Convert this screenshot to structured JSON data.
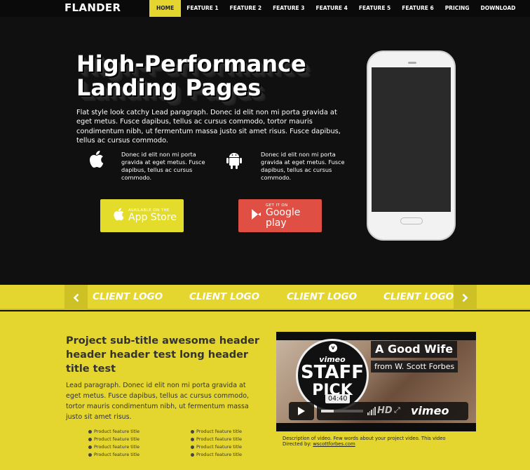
{
  "nav": {
    "brand": "FLANDER",
    "items": [
      {
        "label": "HOME",
        "active": true
      },
      {
        "label": "FEATURE 1"
      },
      {
        "label": "FEATURE 2"
      },
      {
        "label": "FEATURE 3"
      },
      {
        "label": "FEATURE 4"
      },
      {
        "label": "FEATURE 5"
      },
      {
        "label": "FEATURE 6"
      },
      {
        "label": "PRICING"
      },
      {
        "label": "DOWNLOAD"
      }
    ],
    "accent": "#e5d62f"
  },
  "hero": {
    "title": "High-Performance Landing Pages",
    "lead": "Flat style look catchy Lead paragraph. Donec id elit non mi porta gravida at eget metus. Fusce dapibus, tellus ac cursus commodo, tortor mauris condimentum nibh, ut fermentum massa justo sit amet risus. Fusce dapibus, tellus ac cursus commodo.",
    "platforms": [
      {
        "icon": "apple-icon",
        "text": "Donec id elit non mi porta gravida at eget metus. Fusce dapibus, tellus ac cursus commodo."
      },
      {
        "icon": "android-icon",
        "text": "Donec id elit non mi porta gravida at eget metus. Fusce dapibus, tellus ac cursus commodo."
      }
    ],
    "app_store": {
      "small": "AVAILABLE ON THE",
      "big": "App Store",
      "color": "#e4dc2b"
    },
    "google_play": {
      "small": "GET IT ON",
      "big": "Google play",
      "color": "#e04f44"
    }
  },
  "clients": {
    "logos": [
      "CLIENT LOGO",
      "CLIENT LOGO",
      "CLIENT LOGO",
      "CLIENT LOGO"
    ],
    "prev_icon": "chevron-left-icon",
    "next_icon": "chevron-right-icon"
  },
  "project": {
    "title": "Project sub-title awesome header header header test long header title test",
    "lead": "Lead paragraph. Donec id elit non mi porta gravida at eget metus. Fusce dapibus, tellus ac cursus commodo, tortor mauris condimentum nibh, ut fermentum massa justo sit amet risus.",
    "features": [
      "Product feature title",
      "Product feature title",
      "Product feature title",
      "Product feature title",
      "Product feature title",
      "Product feature title",
      "Product feature title",
      "Product feature title"
    ]
  },
  "video": {
    "title": "A Good Wife",
    "byline": "from W. Scott Forbes",
    "badge_top": "vimeo",
    "badge_main": "STAFF",
    "badge_bottom": "PICK",
    "time": "04:40",
    "hd_label": "HD",
    "logo": "vimeo",
    "progress": 0.3,
    "caption": "Description of video. Few words about your project video. This video",
    "directed_label": "Directed by:",
    "directed_link": "wscottforbes.com"
  }
}
